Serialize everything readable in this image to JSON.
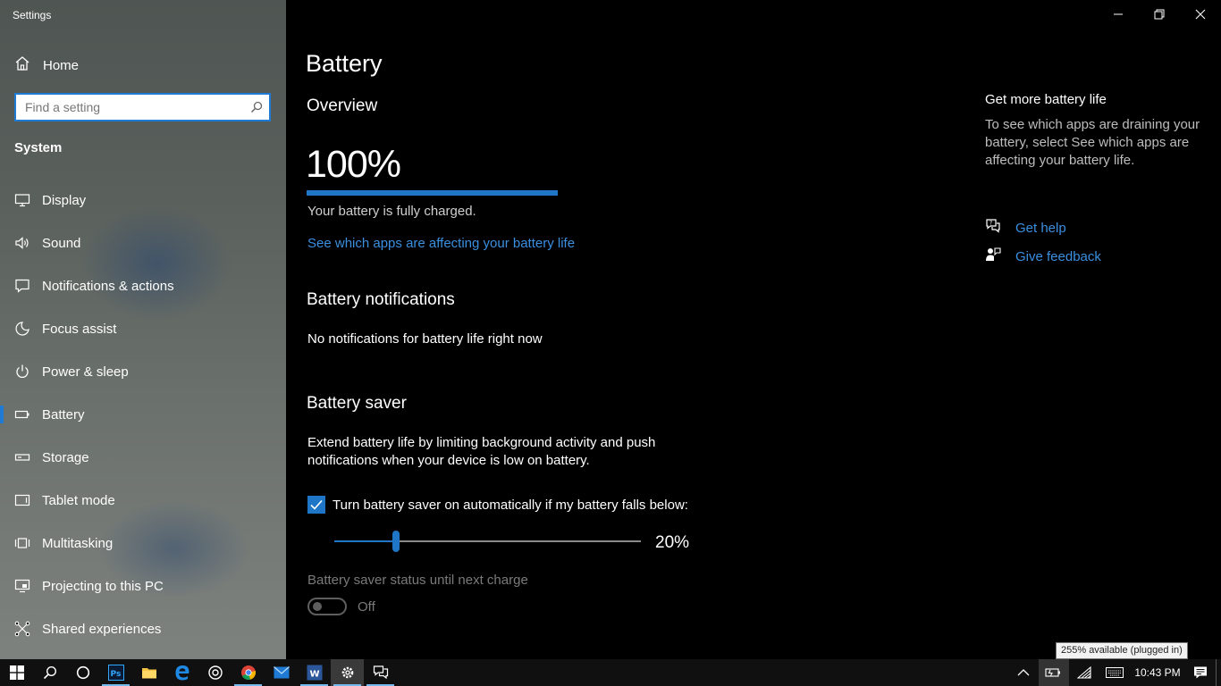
{
  "window": {
    "title": "Settings"
  },
  "sidebar": {
    "home_label": "Home",
    "search_placeholder": "Find a setting",
    "section_title": "System",
    "items": [
      {
        "label": "Display",
        "icon": "monitor-icon"
      },
      {
        "label": "Sound",
        "icon": "speaker-icon"
      },
      {
        "label": "Notifications & actions",
        "icon": "message-icon"
      },
      {
        "label": "Focus assist",
        "icon": "moon-icon"
      },
      {
        "label": "Power & sleep",
        "icon": "power-icon"
      },
      {
        "label": "Battery",
        "icon": "battery-icon",
        "active": true
      },
      {
        "label": "Storage",
        "icon": "storage-icon"
      },
      {
        "label": "Tablet mode",
        "icon": "tablet-icon"
      },
      {
        "label": "Multitasking",
        "icon": "multitasking-icon"
      },
      {
        "label": "Projecting to this PC",
        "icon": "projector-icon"
      },
      {
        "label": "Shared experiences",
        "icon": "share-icon"
      }
    ]
  },
  "main": {
    "title": "Battery",
    "overview": {
      "heading": "Overview",
      "percent_text": "100%",
      "level": 1.0,
      "status": "Your battery is fully charged.",
      "apps_link": "See which apps are affecting your battery life"
    },
    "notifications": {
      "heading": "Battery notifications",
      "text": "No notifications for battery life right now"
    },
    "saver": {
      "heading": "Battery saver",
      "description": "Extend battery life by limiting background activity and push notifications when your device is low on battery.",
      "auto_checkbox_label": "Turn battery saver on automatically if my battery falls below:",
      "auto_checked": true,
      "threshold_value": 0.2,
      "threshold_text": "20%",
      "status_label": "Battery saver status until next charge",
      "status_toggle": "Off"
    }
  },
  "side": {
    "title": "Get more battery life",
    "description": "To see which apps are draining your battery, select See which apps are affecting your battery life.",
    "help_link": "Get help",
    "feedback_link": "Give feedback"
  },
  "tooltip": "255% available (plugged in)",
  "taskbar": {
    "apps": [
      {
        "name": "start-button",
        "icon": "windows-logo-icon"
      },
      {
        "name": "search-button",
        "icon": "search-icon"
      },
      {
        "name": "cortana-button",
        "icon": "cortana-ring-icon"
      },
      {
        "name": "photoshop-button",
        "icon": "photoshop-icon",
        "ps_text": "Ps"
      },
      {
        "name": "file-explorer-button",
        "icon": "folder-icon"
      },
      {
        "name": "edge-button",
        "icon": "edge-icon"
      },
      {
        "name": "camera-button",
        "icon": "camera-icon"
      },
      {
        "name": "chrome-button",
        "icon": "chrome-icon"
      },
      {
        "name": "mail-button",
        "icon": "mail-icon"
      },
      {
        "name": "word-button",
        "icon": "word-icon",
        "word_text": "W"
      },
      {
        "name": "settings-button",
        "icon": "gear-icon"
      },
      {
        "name": "feedback-hub-button",
        "icon": "feedback-icon"
      }
    ],
    "clock": "10:43 PM"
  },
  "colors": {
    "accent": "#1f76c7",
    "link": "#3b8fe0"
  }
}
